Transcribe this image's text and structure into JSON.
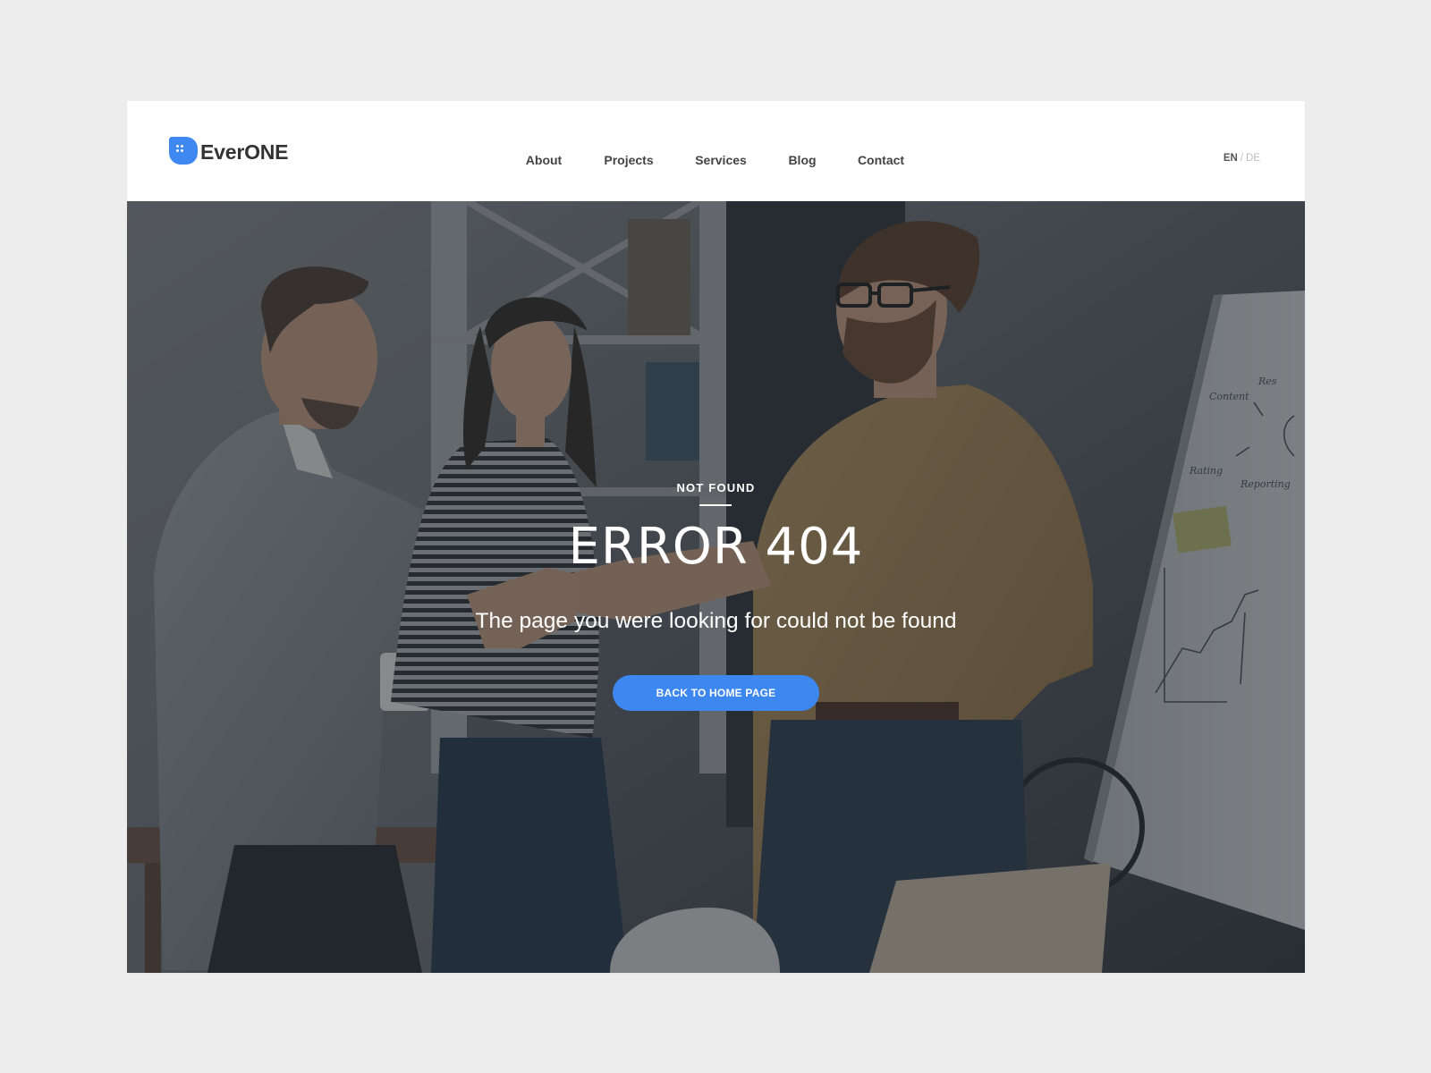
{
  "brand": {
    "name": "EverONE",
    "accent_color": "#3f88f2"
  },
  "nav": {
    "items": [
      {
        "label": "About"
      },
      {
        "label": "Projects"
      },
      {
        "label": "Services"
      },
      {
        "label": "Blog"
      },
      {
        "label": "Contact"
      }
    ]
  },
  "language": {
    "active": "EN",
    "separator": "/",
    "inactive": "DE"
  },
  "hero": {
    "kicker": "NOT FOUND",
    "title": "ERROR 404",
    "subtitle": "The page you were looking for could not be found",
    "button_label": "BACK TO HOME PAGE",
    "button_color": "#3d87f0"
  }
}
